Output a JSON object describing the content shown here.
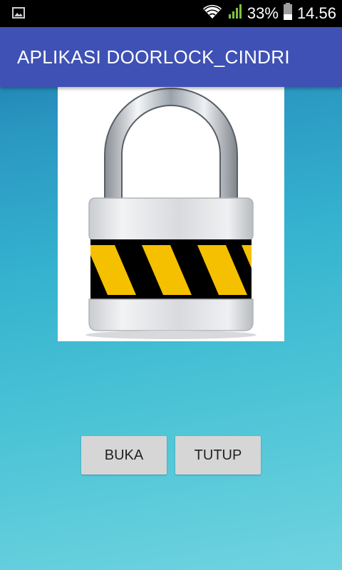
{
  "status_bar": {
    "notification_icon": "image-icon",
    "signal_icons": [
      "wifi-icon",
      "cellular-signal-icon"
    ],
    "battery_percent": "33%",
    "battery_icon": "battery-icon",
    "time": "14.56"
  },
  "app_bar": {
    "title": "APLIKASI DOORLOCK_CINDRI",
    "color": "#3f51b5"
  },
  "lock_image": {
    "icon": "padlock-icon",
    "stripe_colors": [
      "#f5c000",
      "#000000"
    ]
  },
  "buttons": {
    "open_label": "BUKA",
    "close_label": "TUTUP"
  },
  "colors": {
    "status_bar": "#000000",
    "button_bg": "#d6d6d6",
    "background_top": "#1b6fa3",
    "background_bottom": "#6fd3e0"
  }
}
